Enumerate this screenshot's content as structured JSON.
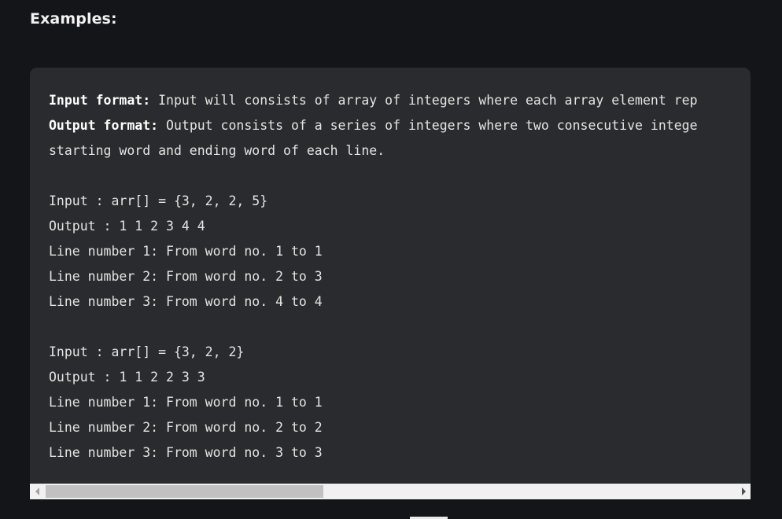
{
  "heading": "Examples:",
  "code": {
    "input_format_label": "Input format:",
    "input_format_text": " Input will consists of array of integers where each array element rep",
    "output_format_label": "Output format:",
    "output_format_text": " Output consists of a series of integers where two consecutive intege",
    "output_format_cont": "starting word and ending word of each line.",
    "example1": {
      "input": "Input : arr[] = {3, 2, 2, 5}",
      "output": "Output : 1 1 2 3 4 4",
      "lines": [
        "Line number 1: From word no. 1 to 1",
        "Line number 2: From word no. 2 to 3",
        "Line number 3: From word no. 4 to 4"
      ]
    },
    "example2": {
      "input": "Input : arr[] = {3, 2, 2}",
      "output": "Output : 1 1 2 2 3 3",
      "lines": [
        "Line number 1: From word no. 1 to 1",
        "Line number 2: From word no. 2 to 2",
        "Line number 3: From word no. 3 to 3"
      ]
    }
  },
  "scrollbar": {
    "left_arrow_icon": "triangle-left-icon",
    "right_arrow_icon": "triangle-right-icon",
    "thumb_fraction": 0.385
  },
  "colors": {
    "page_background": "#141518",
    "code_background": "#2a2b2e",
    "code_text": "#e4e4e4",
    "heading_text": "#f2f2f2"
  }
}
